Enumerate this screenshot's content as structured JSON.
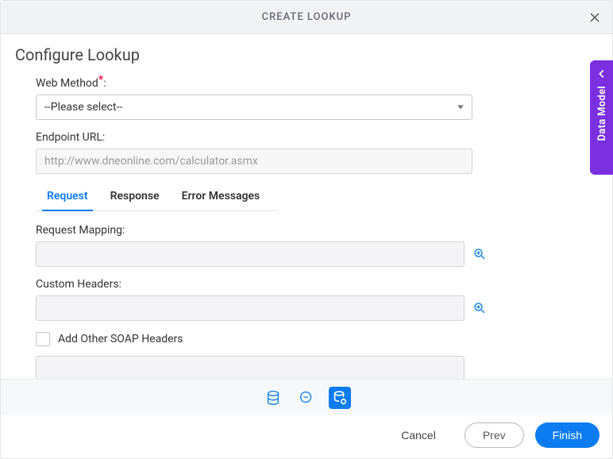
{
  "dialog": {
    "title": "CREATE LOOKUP",
    "section_title": "Configure Lookup"
  },
  "form": {
    "web_method_label": "Web Method",
    "web_method_colon": ":",
    "web_method_value": "--Please select--",
    "endpoint_label": "Endpoint URL:",
    "endpoint_value": "http://www.dneonline.com/calculator.asmx"
  },
  "tabs": {
    "items": [
      {
        "label": "Request",
        "active": true
      },
      {
        "label": "Response",
        "active": false
      },
      {
        "label": "Error Messages",
        "active": false
      }
    ]
  },
  "panel": {
    "request_mapping_label": "Request Mapping:",
    "custom_headers_label": "Custom Headers:",
    "soap_checkbox_label": "Add Other SOAP Headers"
  },
  "footer": {
    "cancel": "Cancel",
    "prev": "Prev",
    "finish": "Finish"
  },
  "side_drawer": {
    "label": "Data Model"
  }
}
